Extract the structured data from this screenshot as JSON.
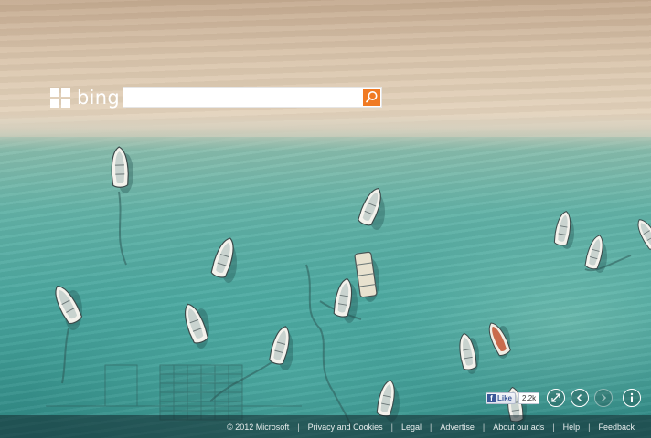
{
  "brand": {
    "name": "bing"
  },
  "search": {
    "placeholder": "",
    "value": "",
    "button_icon": "magnifier-icon",
    "accent": "#f07a23"
  },
  "social": {
    "like_label": "Like",
    "like_count": "2.2k"
  },
  "controls": {
    "fullscreen_icon": "expand-icon",
    "previous_icon": "chevron-left-icon",
    "next_icon": "chevron-right-icon",
    "info_icon": "info-icon"
  },
  "footer": {
    "copyright": "© 2012 Microsoft",
    "links": [
      "Privacy and Cookies",
      "Legal",
      "Advertise",
      "About our ads",
      "Help",
      "Feedback"
    ]
  }
}
